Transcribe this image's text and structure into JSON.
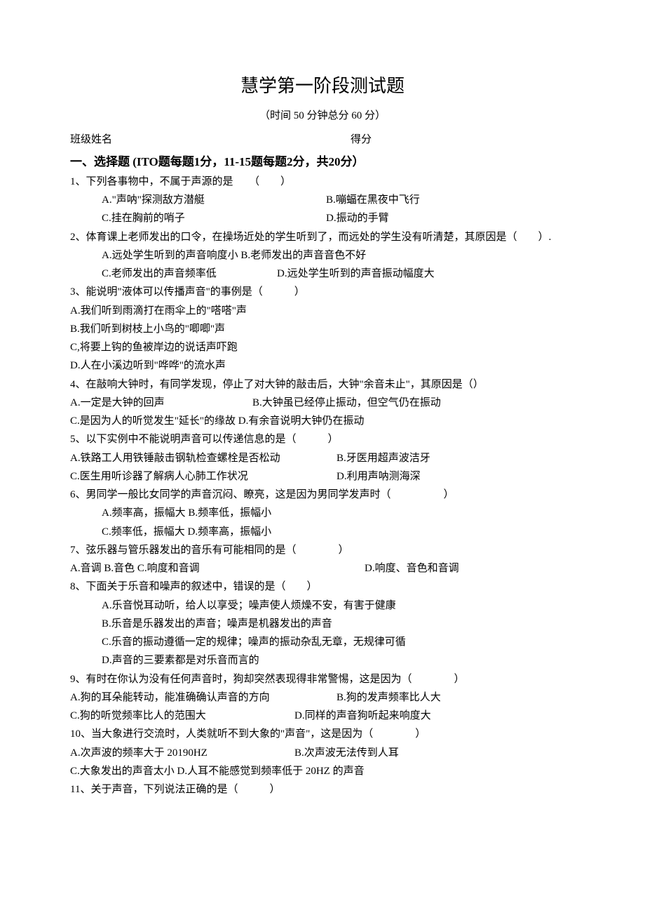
{
  "title": "慧学第一阶段测试题",
  "subtitle": "（时间 50 分钟总分 60 分）",
  "header": {
    "class_name": "班级姓名",
    "score_label": "得分"
  },
  "section1": {
    "heading_prefix": "一、选择题 (ITO",
    "heading_mid": "题每题",
    "heading_1pt": "1",
    "heading_sep": "分，",
    "heading_range": "11-15",
    "heading_2pt": "2",
    "heading_tail": "分，共",
    "heading_total": "20",
    "heading_end": "分）"
  },
  "q1": {
    "stem": "1、下列各事物中，不属于声源的是　　（　　）",
    "a": "A.\"声呐\"探测敌方潜艇",
    "b": "B.嘣蝠在黑夜中飞行",
    "c": "C.挂在胸前的哨子",
    "d": "D.振动的手臂"
  },
  "q2": {
    "stem": "2、体育课上老师发出的口令，在操场近处的学生听到了，而远处的学生没有听清楚，其原因是（　　）.",
    "line1": "A.远处学生听到的声音响度小 B.老师发出的声音音色不好",
    "line2a": "C.老师发出的声音频率低",
    "line2b": "D.远处学生听到的声音振动幅度大"
  },
  "q3": {
    "stem": "3、能说明\"液体可以传播声音\"的事例是（　　　）",
    "a": "A.我们听到雨滴打在雨伞上的\"嗒嗒\"声",
    "b": "B.我们听到树枝上小鸟的\"唧唧\"声",
    "c": "C,将要上钩的鱼被岸边的说话声吓跑",
    "d": "D.人在小溪边听到\"哗哗\"的流水声"
  },
  "q4": {
    "stem": "4、在敲响大钟时，有同学发现，停止了对大钟的敲击后，大钟\"余音未止\"，其原因是（）",
    "line1a": "A.一定是大钟的回声",
    "line1b": "B.大钟虽已经停止振动，但空气仍在振动",
    "line2": "C.是因为人的听觉发生\"延长\"的缘故 D.有余音说明大钟仍在振动"
  },
  "q5": {
    "stem": "5、以下实例中不能说明声音可以传递信息的是（　　　）",
    "line1a": "A.铁路工人用铁锤敲击钢轨检查螺栓是否松动",
    "line1b": "B.牙医用超声波洁牙",
    "line2a": "C.医生用听诊器了解病人心肺工作状况",
    "line2b": "D.利用声呐测海深"
  },
  "q6": {
    "stem": "6、男同学一般比女同学的声音沉闷、瞭亮，这是因为男同学发声时（　　　　　）",
    "line1": "A.频率高，振幅大 B.频率低，振幅小",
    "line2": "C.频率低，振幅大 D.频率高，振幅小"
  },
  "q7": {
    "stem": "7、弦乐器与管乐器发出的音乐有可能相同的是（　　　　）",
    "line1a": "A.音调 B.音色 C.响度和音调",
    "line1b": "D.响度、音色和音调"
  },
  "q8": {
    "stem": "8、下面关于乐音和噪声的叙述中，错误的是（　　）",
    "a": "A.乐音悦耳动听，给人以享受；噪声使人烦燥不安，有害于健康",
    "b": "B.乐音是乐器发出的声音；噪声是机器发出的声音",
    "c": "C.乐音的振动遵循一定的规律；噪声的振动杂乱无章，无规律可循",
    "d": "D.声音的三要素都是对乐音而言的"
  },
  "q9": {
    "stem": "9、有时在你认为没有任何声音时，狗却突然表现得非常警惕，这是因为（　　　　）",
    "line1a": "A.狗的耳朵能转动，能准确确认声音的方向",
    "line1b": "B.狗的发声频率比人大",
    "line2a": "C.狗的听觉频率比人的范围大",
    "line2b": "D.同样的声音狗听起来响度大"
  },
  "q10": {
    "stem": "10、当大象进行交流时，人类就听不到大象的\"声音\"，这是因为（　　　　）",
    "line1a": "A.次声波的频率大于 20190HZ",
    "line1b": "B.次声波无法传到人耳",
    "line2": "C.大象发出的声音太小 D.人耳不能感觉到频率低于 20HZ 的声音"
  },
  "q11": {
    "stem": "11、关于声音，下列说法正确的是（　　　）"
  }
}
